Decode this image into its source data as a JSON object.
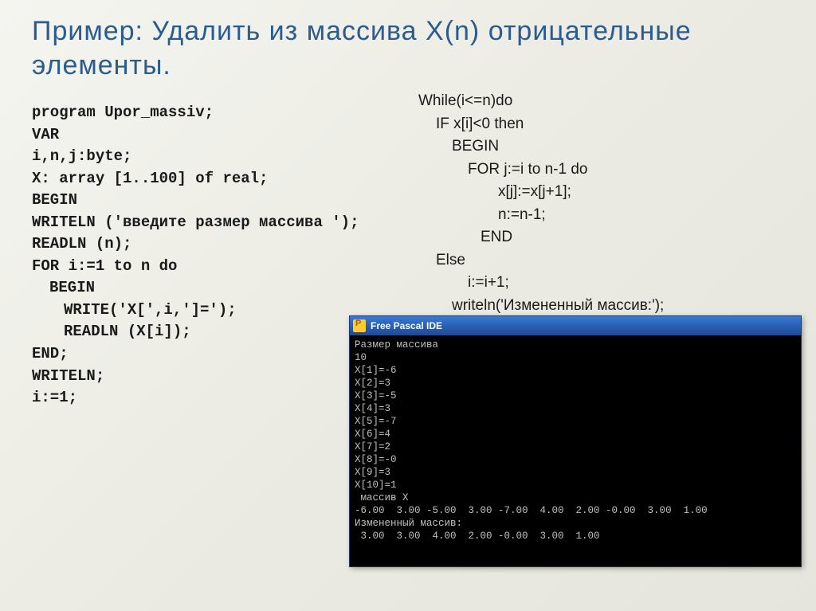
{
  "title": "Пример: Удалить из массива X(n) отрицательные элементы.",
  "code_left": {
    "l0": "program Upor_massiv;",
    "l1": "VAR",
    "l2": "i,n,j:byte;",
    "l3": "X: array [1..100] of real;",
    "l4": "BEGIN",
    "l5": "WRITELN ('введите размер массива ');",
    "l6": "READLN (n);",
    "l7": "FOR i:=1 to n do",
    "l8": "BEGIN",
    "l9": "WRITE('X[',i,']=');",
    "l10": "READLN (X[i]);",
    "l11": "END;",
    "l12": "WRITELN;",
    "l13": "i:=1;"
  },
  "code_right": {
    "r0": "While(i<=n)do",
    "r1": "IF x[i]<0 then",
    "r2": "BEGIN",
    "r3": "FOR j:=i to n-1 do",
    "r4": "x[j]:=x[j+1];",
    "r5": "n:=n-1;",
    "r6": "END",
    "r7": "Else",
    "r8": "i:=i+1;",
    "r9": "writeln('Измененный массив:');"
  },
  "ide": {
    "title": "Free Pascal IDE",
    "terminal": "Размер массива\n10\nX[1]=-6\nX[2]=3\nX[3]=-5\nX[4]=3\nX[5]=-7\nX[6]=4\nX[7]=2\nX[8]=-0\nX[9]=3\nX[10]=1\n массив X\n-6.00  3.00 -5.00  3.00 -7.00  4.00  2.00 -0.00  3.00  1.00\nИзмененный массив:\n 3.00  3.00  4.00  2.00 -0.00  3.00  1.00"
  }
}
